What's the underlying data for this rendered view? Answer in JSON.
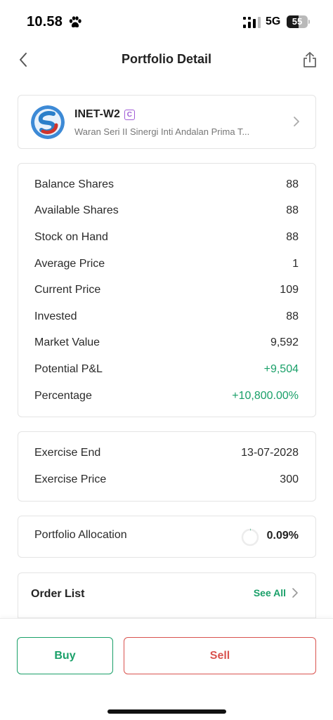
{
  "status_bar": {
    "time": "10.58",
    "network": "5G",
    "battery": "55",
    "battery_level": 0.55
  },
  "header": {
    "title": "Portfolio Detail"
  },
  "stock": {
    "code": "INET-W2",
    "badge": "C",
    "name": "Waran Seri II Sinergi Inti Andalan Prima T...",
    "logo_colors": {
      "blue": "#2b7fc9",
      "red": "#d0342c"
    }
  },
  "details": [
    {
      "label": "Balance Shares",
      "value": "88",
      "tone": "normal"
    },
    {
      "label": "Available Shares",
      "value": "88",
      "tone": "normal"
    },
    {
      "label": "Stock on Hand",
      "value": "88",
      "tone": "normal"
    },
    {
      "label": "Average Price",
      "value": "1",
      "tone": "normal"
    },
    {
      "label": "Current Price",
      "value": "109",
      "tone": "normal"
    },
    {
      "label": "Invested",
      "value": "88",
      "tone": "normal"
    },
    {
      "label": "Market Value",
      "value": "9,592",
      "tone": "normal"
    },
    {
      "label": "Potential P&L",
      "value": "+9,504",
      "tone": "positive"
    },
    {
      "label": "Percentage",
      "value": "+10,800.00%",
      "tone": "positive"
    }
  ],
  "exercise": [
    {
      "label": "Exercise End",
      "value": "13-07-2028"
    },
    {
      "label": "Exercise Price",
      "value": "300"
    }
  ],
  "allocation": {
    "label": "Portfolio Allocation",
    "value": "0.09%",
    "fraction": 0.0009
  },
  "order_list": {
    "title": "Order List",
    "see_all": "See All"
  },
  "actions": {
    "buy": "Buy",
    "sell": "Sell"
  },
  "colors": {
    "positive": "#1aa069",
    "negative": "#d9534f",
    "badge": "#a05bd6"
  }
}
